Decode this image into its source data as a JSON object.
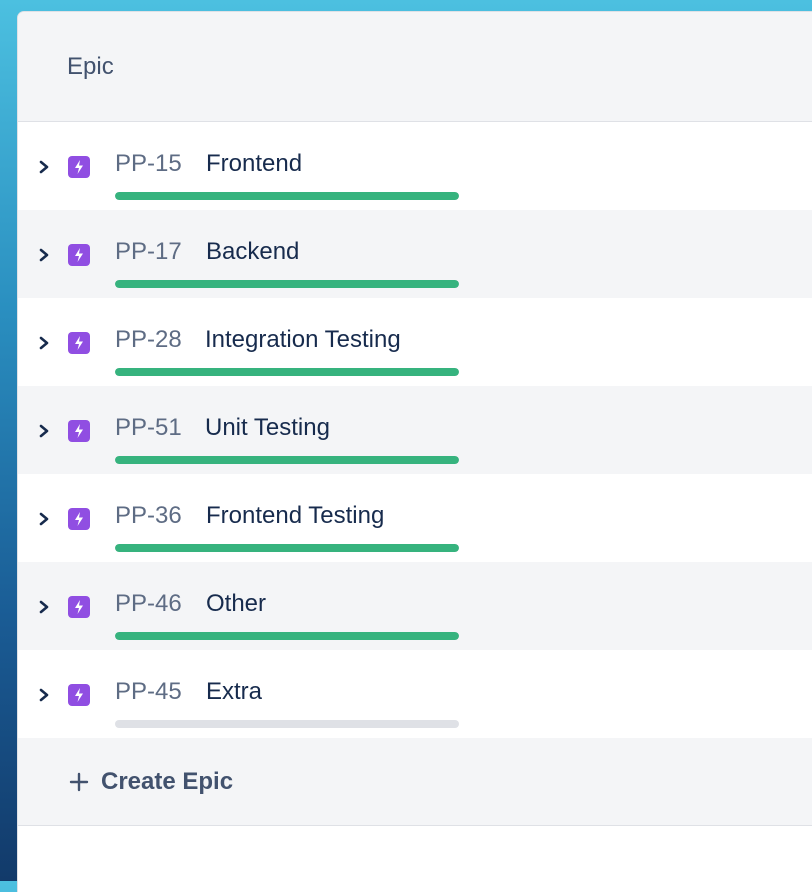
{
  "header": {
    "title": "Epic"
  },
  "epics": [
    {
      "key": "PP-15",
      "summary": "Frontend",
      "progress": 1.0
    },
    {
      "key": "PP-17",
      "summary": "Backend",
      "progress": 1.0
    },
    {
      "key": "PP-28",
      "summary": "Integration Testing",
      "progress": 1.0
    },
    {
      "key": "PP-51",
      "summary": "Unit Testing",
      "progress": 1.0
    },
    {
      "key": "PP-36",
      "summary": "Frontend Testing",
      "progress": 1.0
    },
    {
      "key": "PP-46",
      "summary": "Other",
      "progress": 1.0
    },
    {
      "key": "PP-45",
      "summary": "Extra",
      "progress": 0.0
    }
  ],
  "create": {
    "label": "Create Epic",
    "icon": "plus-icon"
  },
  "icons": {
    "expand": "chevron-right-icon",
    "epic": "epic-lightning-icon"
  },
  "colors": {
    "epic_icon": "#904ee2",
    "progress_done": "#36b37e",
    "progress_track": "#dfe1e6"
  }
}
